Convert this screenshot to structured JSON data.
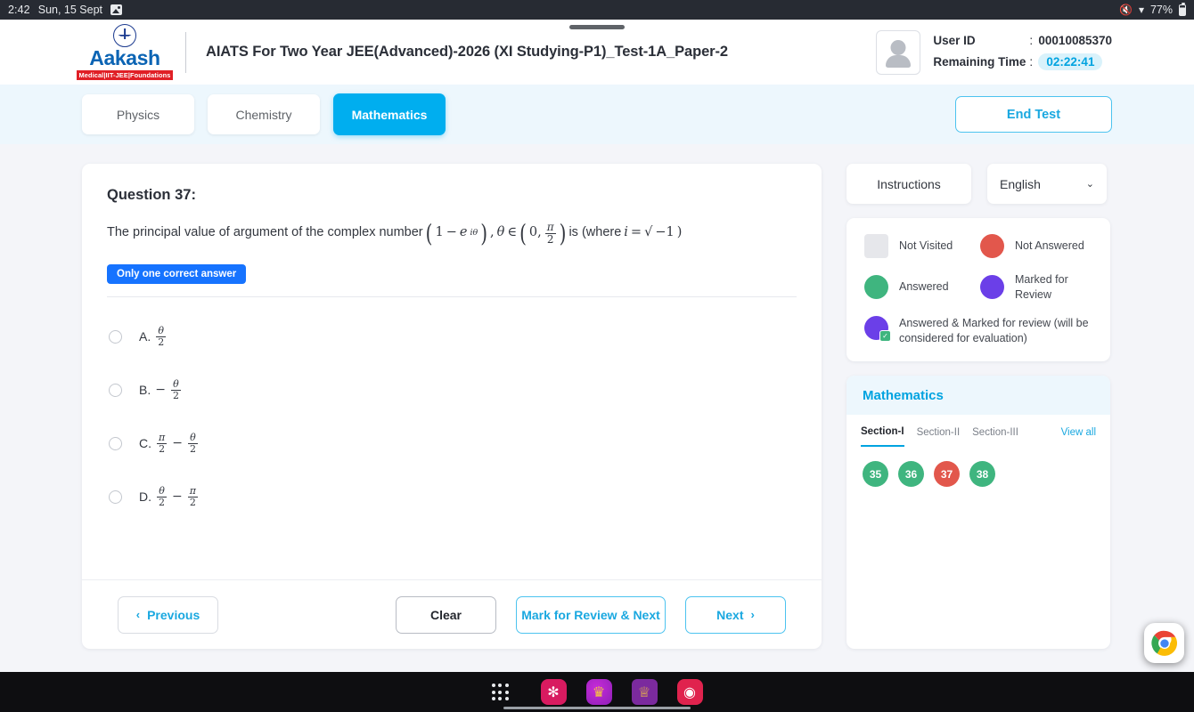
{
  "statusbar": {
    "time": "2:42",
    "date": "Sun, 15 Sept",
    "image_icon": "image-icon",
    "mute_icon": "mute-icon",
    "wifi_icon": "wifi-icon",
    "battery": "77%"
  },
  "header": {
    "logo_word": "Aakash",
    "logo_tagline": "Medical|IIT-JEE|Foundations",
    "test_title": "AIATS For Two Year JEE(Advanced)-2026 (XI Studying-P1)_Test-1A_Paper-2",
    "user_id_label": "User ID",
    "user_id_colon": ":",
    "user_id_value": "00010085370",
    "remaining_label": "Remaining Time",
    "remaining_colon": ":",
    "remaining_value": "02:22:41",
    "accent_color": "#00aeef",
    "time_chip_bg": "#d9f2fb"
  },
  "tabbar": {
    "subjects": [
      {
        "label": "Physics",
        "active": false
      },
      {
        "label": "Chemistry",
        "active": false
      },
      {
        "label": "Mathematics",
        "active": true
      }
    ],
    "end_test_label": "End Test"
  },
  "question": {
    "title": "Question 37:",
    "stem_prefix": "The principal value of argument of the complex number",
    "expr_open": "(",
    "expr_one": "1",
    "expr_minus": "−",
    "expr_e": "e",
    "expr_e_sup": "iθ",
    "expr_close": ")",
    "expr_comma": ",",
    "theta": "θ",
    "in_sym": "∈",
    "range_open": "(",
    "range_zero": "0,",
    "range_pi": "π",
    "range_two": "2",
    "range_close": ")",
    "stem_suffix": "is (where",
    "i_sym": "i",
    "equals": "=",
    "sqrt_sym": "√",
    "sqrt_inner": "−1",
    "tail_paren": ")",
    "badge": "Only one correct answer",
    "options": [
      {
        "letter": "A.",
        "type": "frac",
        "num": "θ",
        "den": "2",
        "lead": ""
      },
      {
        "letter": "B.",
        "type": "frac",
        "num": "θ",
        "den": "2",
        "lead": "−"
      },
      {
        "letter": "C.",
        "type": "fracminusfrac",
        "n1": "π",
        "d1": "2",
        "op": "−",
        "n2": "θ",
        "d2": "2"
      },
      {
        "letter": "D.",
        "type": "fracminusfrac",
        "n1": "θ",
        "d1": "2",
        "op": "−",
        "n2": "π",
        "d2": "2"
      }
    ]
  },
  "footer": {
    "previous": "Previous",
    "prev_chevron": "‹",
    "clear": "Clear",
    "mark_review_next": "Mark for Review & Next",
    "next": "Next",
    "next_chevron": "›"
  },
  "rail": {
    "instructions": "Instructions",
    "language": "English",
    "language_chevron": "⌄",
    "legend": [
      {
        "label": "Not Visited",
        "shape": "square",
        "color": "#e6e7eb"
      },
      {
        "label": "Not Answered",
        "shape": "circle",
        "color": "#e2574c"
      },
      {
        "label": "Answered",
        "shape": "circle",
        "color": "#3fb57f"
      },
      {
        "label": "Marked for Review",
        "shape": "circle",
        "color": "#6b3fe8"
      },
      {
        "label": "Answered & Marked for review (will be considered for evaluation)",
        "shape": "circle-tick",
        "color": "#6b3fe8",
        "tick_color": "#3fb57f"
      }
    ],
    "palette_title": "Mathematics",
    "sections": [
      {
        "label": "Section-I",
        "active": true
      },
      {
        "label": "Section-II",
        "active": false
      },
      {
        "label": "Section-III",
        "active": false
      }
    ],
    "view_all": "View all",
    "questions": [
      {
        "num": "35",
        "status": "answered",
        "color": "#3fb57f"
      },
      {
        "num": "36",
        "status": "answered",
        "color": "#3fb57f"
      },
      {
        "num": "37",
        "status": "not-answered",
        "color": "#e2574c"
      },
      {
        "num": "38",
        "status": "answered",
        "color": "#3fb57f"
      }
    ]
  },
  "taskbar": {
    "app_grid": "app-grid-icon",
    "apps": [
      {
        "name": "flower-app-icon",
        "glyph": "✻"
      },
      {
        "name": "purple-app-icon",
        "glyph": "♛"
      },
      {
        "name": "violet-app-icon",
        "glyph": "♕"
      },
      {
        "name": "camera-app-icon",
        "glyph": "◉"
      }
    ],
    "chrome": "chrome-icon"
  }
}
